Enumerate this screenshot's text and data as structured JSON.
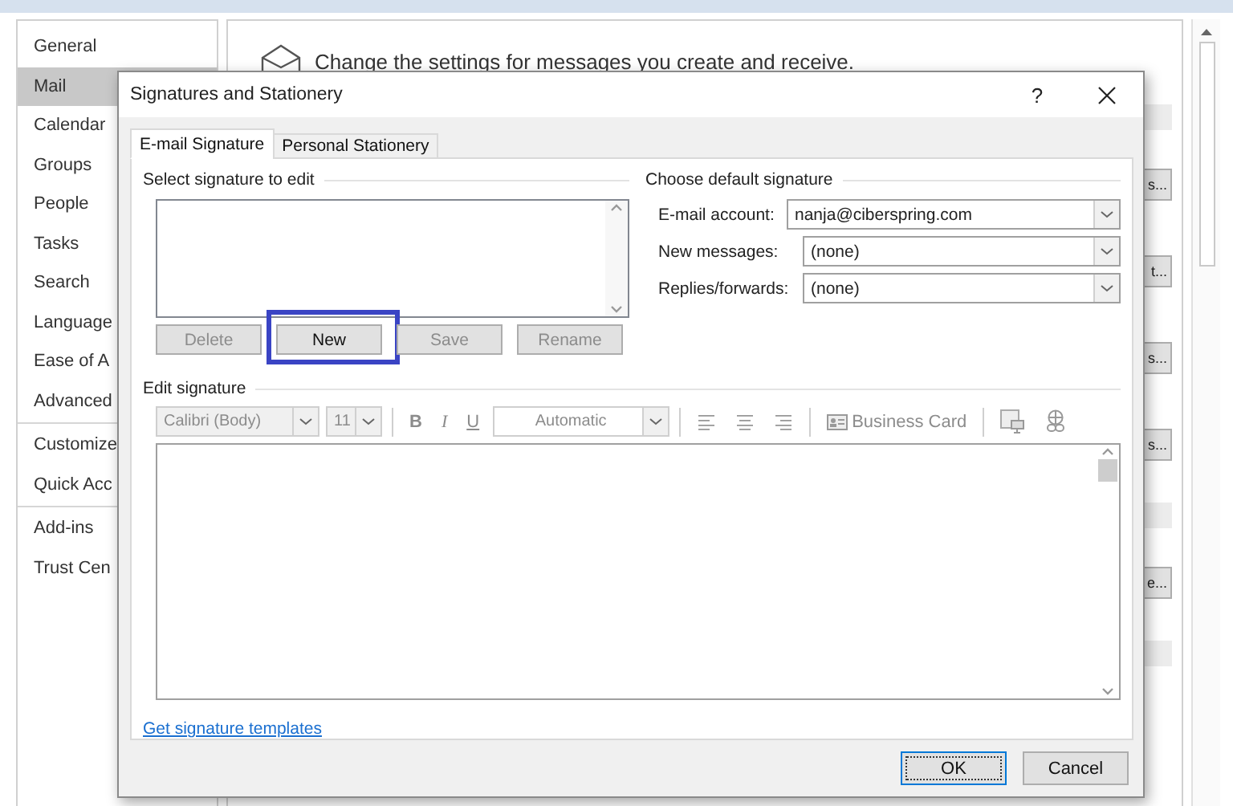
{
  "options_window": {
    "sidebar": {
      "groups": [
        {
          "items": [
            {
              "label": "General",
              "selected": false
            },
            {
              "label": "Mail",
              "selected": true
            },
            {
              "label": "Calendar",
              "selected": false
            },
            {
              "label": "Groups",
              "selected": false
            },
            {
              "label": "People",
              "selected": false
            },
            {
              "label": "Tasks",
              "selected": false
            },
            {
              "label": "Search",
              "selected": false
            },
            {
              "label": "Language",
              "selected": false
            },
            {
              "label": "Ease of A",
              "selected": false
            },
            {
              "label": "Advanced",
              "selected": false
            }
          ]
        },
        {
          "items": [
            {
              "label": "Customize",
              "selected": false
            },
            {
              "label": "Quick Acc",
              "selected": false
            }
          ]
        },
        {
          "items": [
            {
              "label": "Add-ins",
              "selected": false
            },
            {
              "label": "Trust Cen",
              "selected": false
            }
          ]
        }
      ]
    },
    "header": "Change the settings for messages you create and receive.",
    "sections": [
      {
        "kind": "bar"
      },
      {
        "kind": "button",
        "label": "s..."
      },
      {
        "kind": "button",
        "label": "t..."
      },
      {
        "kind": "button",
        "label": "s..."
      },
      {
        "kind": "button",
        "label": "s..."
      },
      {
        "kind": "bar"
      },
      {
        "kind": "button",
        "label": "e..."
      },
      {
        "kind": "bar"
      }
    ]
  },
  "dialog": {
    "title": "Signatures and Stationery",
    "help": "?",
    "tabs": [
      {
        "label": "E-mail Signature",
        "selected": true
      },
      {
        "label": "Personal Stationery",
        "selected": false
      }
    ],
    "select_signature": {
      "label": "Select signature to edit",
      "buttons": [
        {
          "label": "Delete",
          "disabled": true,
          "highlighted": false
        },
        {
          "label": "New",
          "disabled": false,
          "highlighted": true
        },
        {
          "label": "Save",
          "disabled": true,
          "highlighted": false
        },
        {
          "label": "Rename",
          "disabled": true,
          "highlighted": false
        }
      ]
    },
    "default_signature": {
      "label": "Choose default signature",
      "fields": [
        {
          "label": "E-mail account:",
          "value": "nanja@ciberspring.com"
        },
        {
          "label": "New messages:",
          "value": "(none)"
        },
        {
          "label": "Replies/forwards:",
          "value": "(none)"
        }
      ]
    },
    "edit_signature": {
      "label": "Edit signature",
      "font": "Calibri (Body)",
      "size": "11",
      "format_buttons": [
        {
          "label": "B",
          "kind": "bold"
        },
        {
          "label": "I",
          "kind": "italic"
        },
        {
          "label": "U",
          "kind": "underline"
        }
      ],
      "tint": "Automatic",
      "business_card": "Business Card"
    },
    "link": "Get signature templates",
    "buttons": [
      {
        "label": "OK",
        "default": true
      },
      {
        "label": "Cancel",
        "default": false
      }
    ]
  }
}
